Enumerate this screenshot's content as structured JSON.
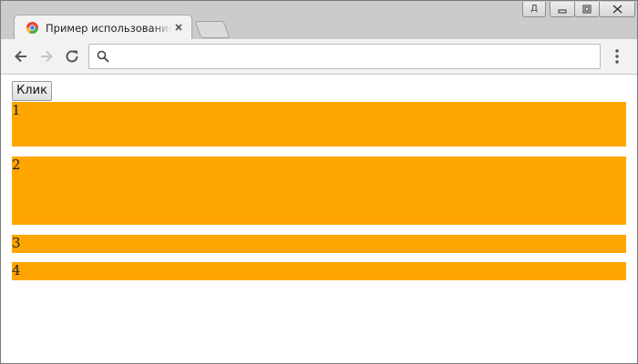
{
  "browser": {
    "tab": {
      "title": "Пример использования jQuery",
      "favicon": "chrome-page-icon"
    },
    "window_buttons": {
      "user_label": "Д",
      "minimize_icon": "minimize-icon",
      "restore_icon": "restore-icon",
      "close_icon": "close-icon"
    },
    "toolbar": {
      "back_icon": "arrow-left-icon",
      "forward_icon": "arrow-right-icon",
      "reload_icon": "reload-icon",
      "omnibox_value": "",
      "omnibox_icon": "search-icon",
      "menu_icon": "kebab-menu-icon"
    }
  },
  "page": {
    "button_label": "Клик",
    "box_color": "#ffa500",
    "boxes": [
      {
        "label": "1"
      },
      {
        "label": "2"
      },
      {
        "label": "3"
      },
      {
        "label": "4"
      }
    ]
  }
}
